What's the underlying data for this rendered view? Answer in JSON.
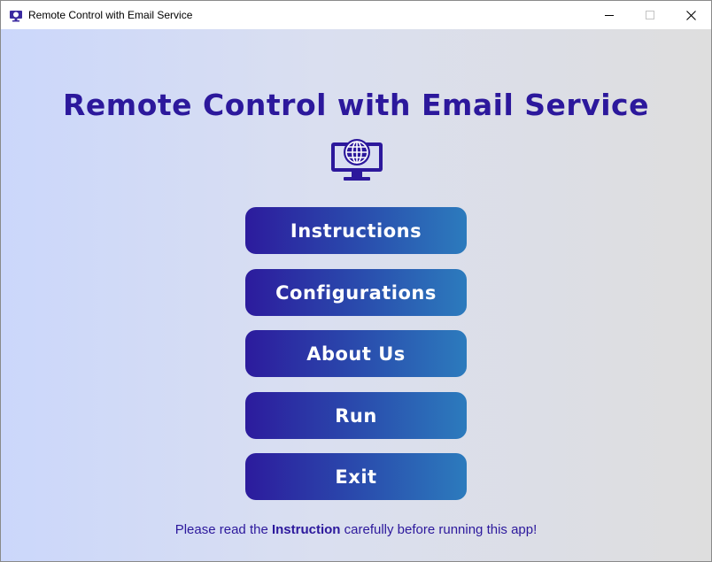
{
  "window": {
    "title": "Remote Control with Email Service"
  },
  "app": {
    "heading": "Remote Control with Email Service",
    "icon": "monitor-globe-icon"
  },
  "menu": {
    "instructions_label": "Instructions",
    "configurations_label": "Configurations",
    "about_label": "About Us",
    "run_label": "Run",
    "exit_label": "Exit"
  },
  "footer": {
    "before": "Please read the ",
    "emphasis": "Instruction",
    "after": " carefully before running this app!"
  },
  "colors": {
    "accent": "#2c189c",
    "button_start": "#2c1b9d",
    "button_end": "#2c7bbd",
    "background_left": "#cbd7fb",
    "background_right": "#dedede"
  }
}
